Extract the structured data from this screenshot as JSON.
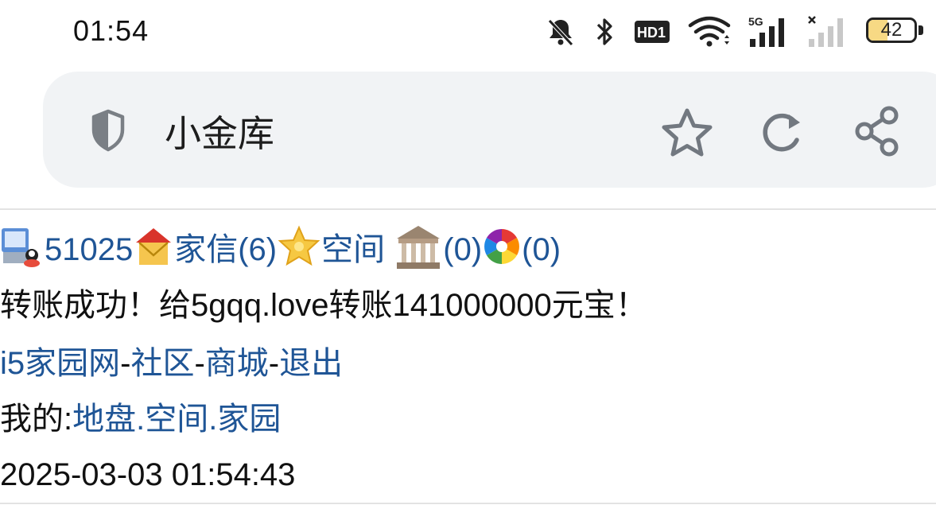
{
  "status_bar": {
    "time": "01:54",
    "network_label": "5G",
    "hd_label": "HD1",
    "battery_level": 42,
    "battery_text": "42"
  },
  "address_bar": {
    "title": "小金库",
    "icons": [
      "shield-icon",
      "star-icon",
      "reload-icon",
      "share-icon"
    ]
  },
  "header_links": {
    "user_id": "51025",
    "mail": "家信(6)",
    "space": "空间",
    "bank_count": "(0)",
    "photo_count": "(0)"
  },
  "message": "转账成功！给5gqq.love转账141000000元宝！",
  "nav": {
    "home": "i5家园网",
    "sep": "-",
    "community": "社区",
    "mall": "商城",
    "logout": "退出"
  },
  "mine": {
    "label": "我的:",
    "land": "地盘",
    "dot": ".",
    "space": "空间",
    "home": "家园"
  },
  "timestamp": "2025-03-03 01:54:43",
  "colors": {
    "link": "#1f5596",
    "address_bg": "#f1f3f5",
    "battery_fill": "#f7d984"
  }
}
